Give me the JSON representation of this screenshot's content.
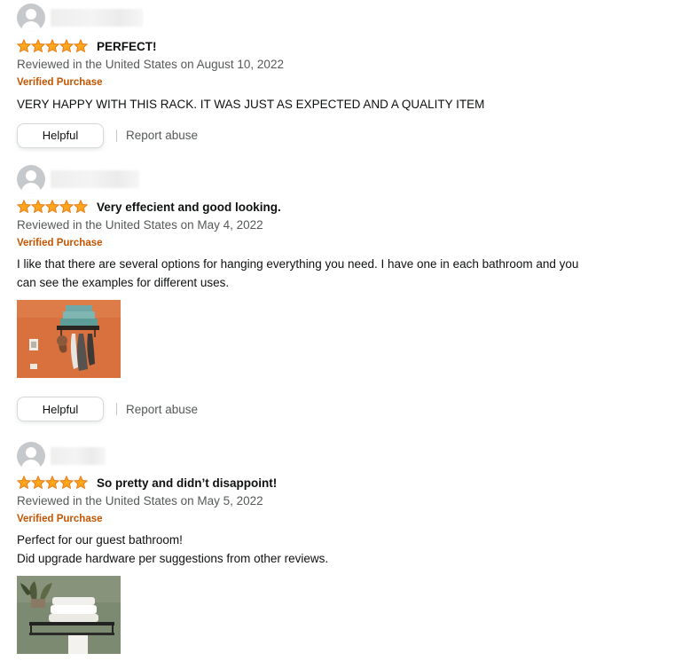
{
  "colors": {
    "star": "#ffa41c",
    "verified": "#c45500",
    "secondary_text": "#565959",
    "primary_text": "#0f1111"
  },
  "icons": {
    "avatar": "default-user-avatar-icon",
    "star": "filled-star-icon"
  },
  "reviews": [
    {
      "rating": 5,
      "max_rating": 5,
      "title": "PERFECT!",
      "date": "Reviewed in the United States on August 10, 2022",
      "verified": "Verified Purchase",
      "body_lines": [
        "VERY HAPPY WITH THIS RACK. IT WAS JUST AS EXPECTED AND A QUALITY ITEM"
      ],
      "helpful_label": "Helpful",
      "report_label": "Report abuse"
    },
    {
      "rating": 5,
      "max_rating": 5,
      "title": "Very effecient and good looking.",
      "date": "Reviewed in the United States on May 4, 2022",
      "verified": "Verified Purchase",
      "body_lines": [
        "I like that there are several options for hanging everything you need. I have one in each bathroom and you",
        "can see the examples for different uses."
      ],
      "helpful_label": "Helpful",
      "report_label": "Report abuse"
    },
    {
      "rating": 5,
      "max_rating": 5,
      "title": "So pretty and didn’t disappoint!",
      "date": "Reviewed in the United States on May 5, 2022",
      "verified": "Verified Purchase",
      "body_lines": [
        "Perfect for our guest bathroom!",
        "Did upgrade hardware per suggestions from other reviews."
      ]
    }
  ]
}
